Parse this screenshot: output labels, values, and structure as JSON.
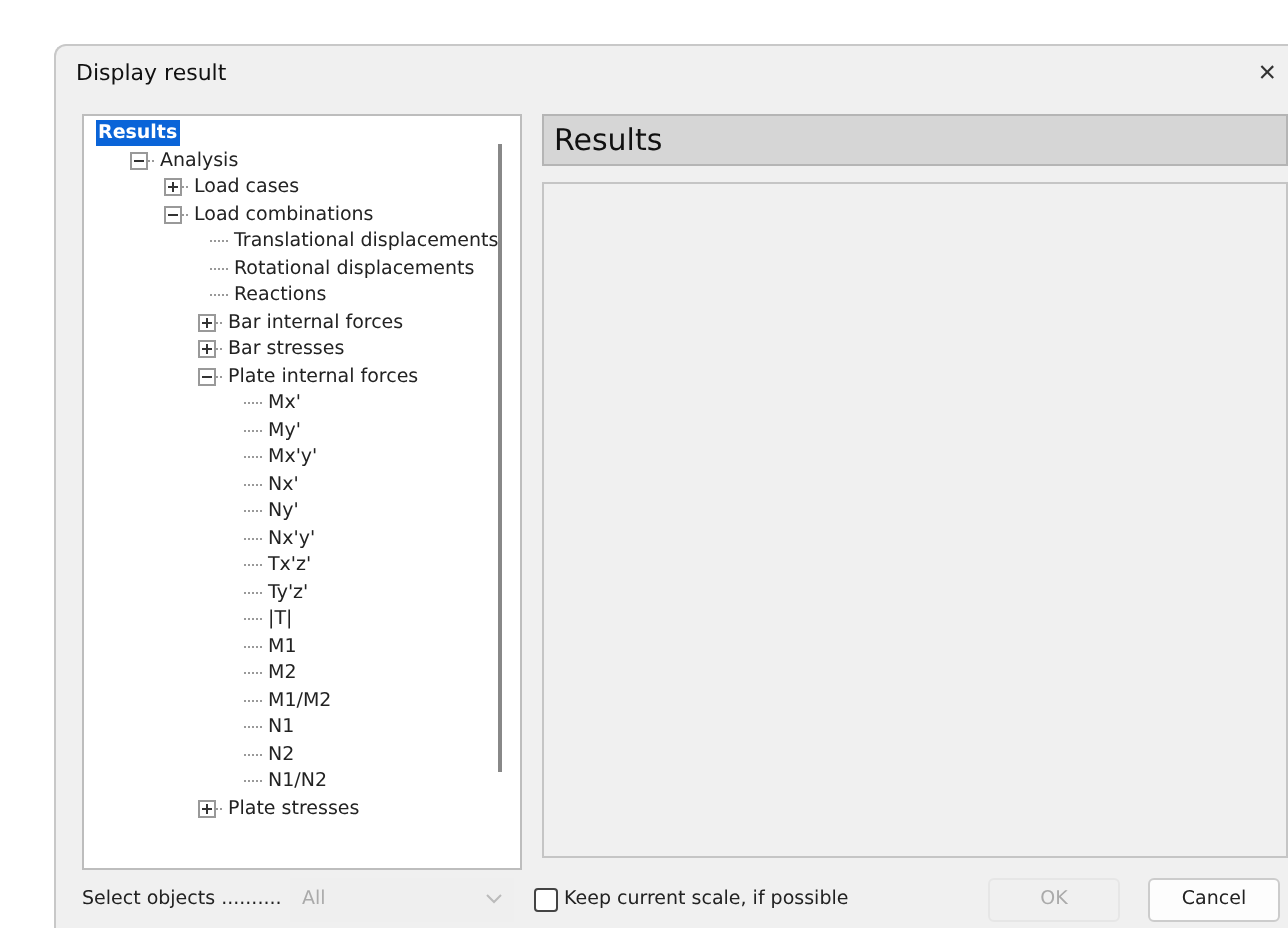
{
  "window": {
    "title": "Display result",
    "close": "×"
  },
  "tree": [
    {
      "label": "Results",
      "selected": true,
      "children": [
        {
          "label": "Analysis",
          "selected": false,
          "expanded": true,
          "children": [
            {
              "label": "Load cases",
              "selected": false,
              "expanded": false
            },
            {
              "label": "Load combinations",
              "selected": false,
              "expanded": true,
              "children": [
                {
                  "label": "Translational displacements",
                  "selected": false
                },
                {
                  "label": "Rotational displacements",
                  "selected": false
                },
                {
                  "label": "Reactions",
                  "selected": false
                },
                {
                  "label": "Bar internal forces",
                  "selected": false,
                  "expanded": false
                },
                {
                  "label": "Bar stresses",
                  "selected": false,
                  "expanded": false
                },
                {
                  "label": "Plate internal forces",
                  "selected": false,
                  "expanded": true,
                  "children": [
                    {
                      "label": "Mx'",
                      "selected": false
                    },
                    {
                      "label": "My'",
                      "selected": false
                    },
                    {
                      "label": "Mx'y'",
                      "selected": false
                    },
                    {
                      "label": "Nx'",
                      "selected": false
                    },
                    {
                      "label": "Ny'",
                      "selected": false
                    },
                    {
                      "label": "Nx'y'",
                      "selected": false
                    },
                    {
                      "label": "Tx'z'",
                      "selected": false
                    },
                    {
                      "label": "Ty'z'",
                      "selected": false
                    },
                    {
                      "label": "|T|",
                      "selected": false
                    },
                    {
                      "label": "M1",
                      "selected": false
                    },
                    {
                      "label": "M2",
                      "selected": false
                    },
                    {
                      "label": "M1/M2",
                      "selected": false
                    },
                    {
                      "label": "N1",
                      "selected": false
                    },
                    {
                      "label": "N2",
                      "selected": false
                    },
                    {
                      "label": "N1/N2",
                      "selected": false
                    }
                  ]
                },
                {
                  "label": "Plate stresses",
                  "selected": false,
                  "expanded": false
                }
              ]
            }
          ]
        }
      ]
    }
  ],
  "results_panel": {
    "title": "Results"
  },
  "select_objects": {
    "label": "Select objects ..........",
    "value": "All",
    "disabled": true
  },
  "keep_scale": {
    "label": "Keep current scale, if possible",
    "checked": false
  },
  "buttons": [
    {
      "label": "OK",
      "disabled": true
    },
    {
      "label": "Cancel",
      "disabled": false
    }
  ]
}
